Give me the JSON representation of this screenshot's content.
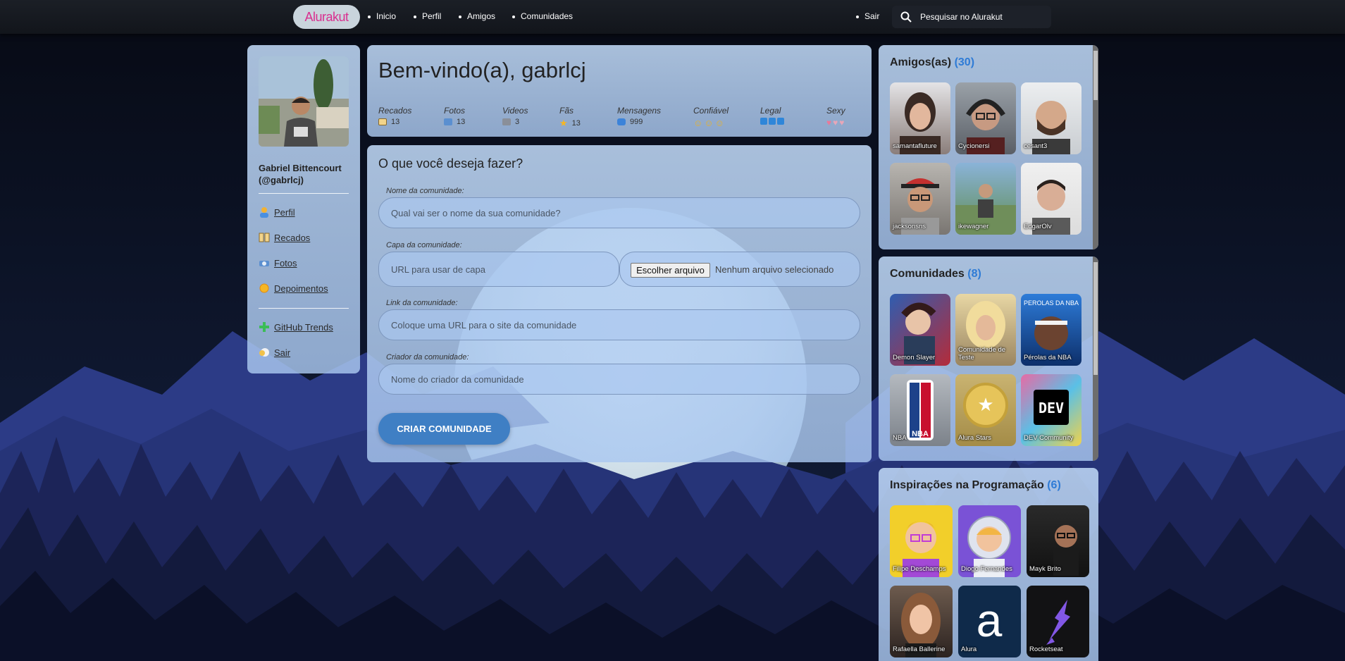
{
  "topbar": {
    "logo": "Alurakut",
    "nav": [
      "Inicio",
      "Perfil",
      "Amigos",
      "Comunidades"
    ],
    "logout": "Sair",
    "search_placeholder": "Pesquisar no Alurakut"
  },
  "profile": {
    "name": "Gabriel Bittencourt (@gabrlcj)",
    "links": [
      {
        "label": "Perfil",
        "icon": "user-icon"
      },
      {
        "label": "Recados",
        "icon": "book-icon"
      },
      {
        "label": "Fotos",
        "icon": "camera-icon"
      },
      {
        "label": "Depoimentos",
        "icon": "sun-icon"
      }
    ],
    "links2": [
      {
        "label": "GitHub Trends",
        "icon": "plus-icon"
      },
      {
        "label": "Sair",
        "icon": "logout-icon"
      }
    ]
  },
  "welcome": {
    "title": "Bem-vindo(a), gabrlcj",
    "stats": [
      {
        "label": "Recados",
        "value": "13"
      },
      {
        "label": "Fotos",
        "value": "13"
      },
      {
        "label": "Videos",
        "value": "3"
      },
      {
        "label": "Fãs",
        "value": "13"
      },
      {
        "label": "Mensagens",
        "value": "999"
      },
      {
        "label": "Confiável",
        "value": ""
      },
      {
        "label": "Legal",
        "value": ""
      },
      {
        "label": "Sexy",
        "value": ""
      }
    ]
  },
  "form": {
    "title": "O que você deseja fazer?",
    "name_label": "Nome da comunidade:",
    "name_placeholder": "Qual vai ser o nome da sua comunidade?",
    "cover_label": "Capa da comunidade:",
    "cover_placeholder": "URL para usar de capa",
    "file_button": "Escolher arquivo",
    "file_status": "Nenhum arquivo selecionado",
    "link_label": "Link da comunidade:",
    "link_placeholder": "Coloque uma URL para o site da comunidade",
    "creator_label": "Criador da comunidade:",
    "creator_placeholder": "Nome do criador da comunidade",
    "submit": "CRIAR COMUNIDADE"
  },
  "friends": {
    "title": "Amigos(as)",
    "count": "(30)",
    "items": [
      "samantafluture",
      "Cycionersi",
      "cesant3",
      "jacksonsns",
      "ikewagner",
      "EdgarOlv"
    ]
  },
  "communities": {
    "title": "Comunidades",
    "count": "(8)",
    "items": [
      "Demon Slayer",
      "Comunidade de Teste",
      "Pérolas da NBA",
      "NBA",
      "Alura Stars",
      "DEV Community"
    ]
  },
  "inspirations": {
    "title": "Inspirações na Programação",
    "count": "(6)",
    "items": [
      "Filipe Deschamps",
      "Diogo Fernandes",
      "Mayk Brito",
      "Rafaella Ballerine",
      "Alura",
      "Rocketseat"
    ]
  },
  "colors": {
    "accent": "#2e7bd6",
    "button": "#3f7fc4",
    "logo_pink": "#d92f8f"
  }
}
